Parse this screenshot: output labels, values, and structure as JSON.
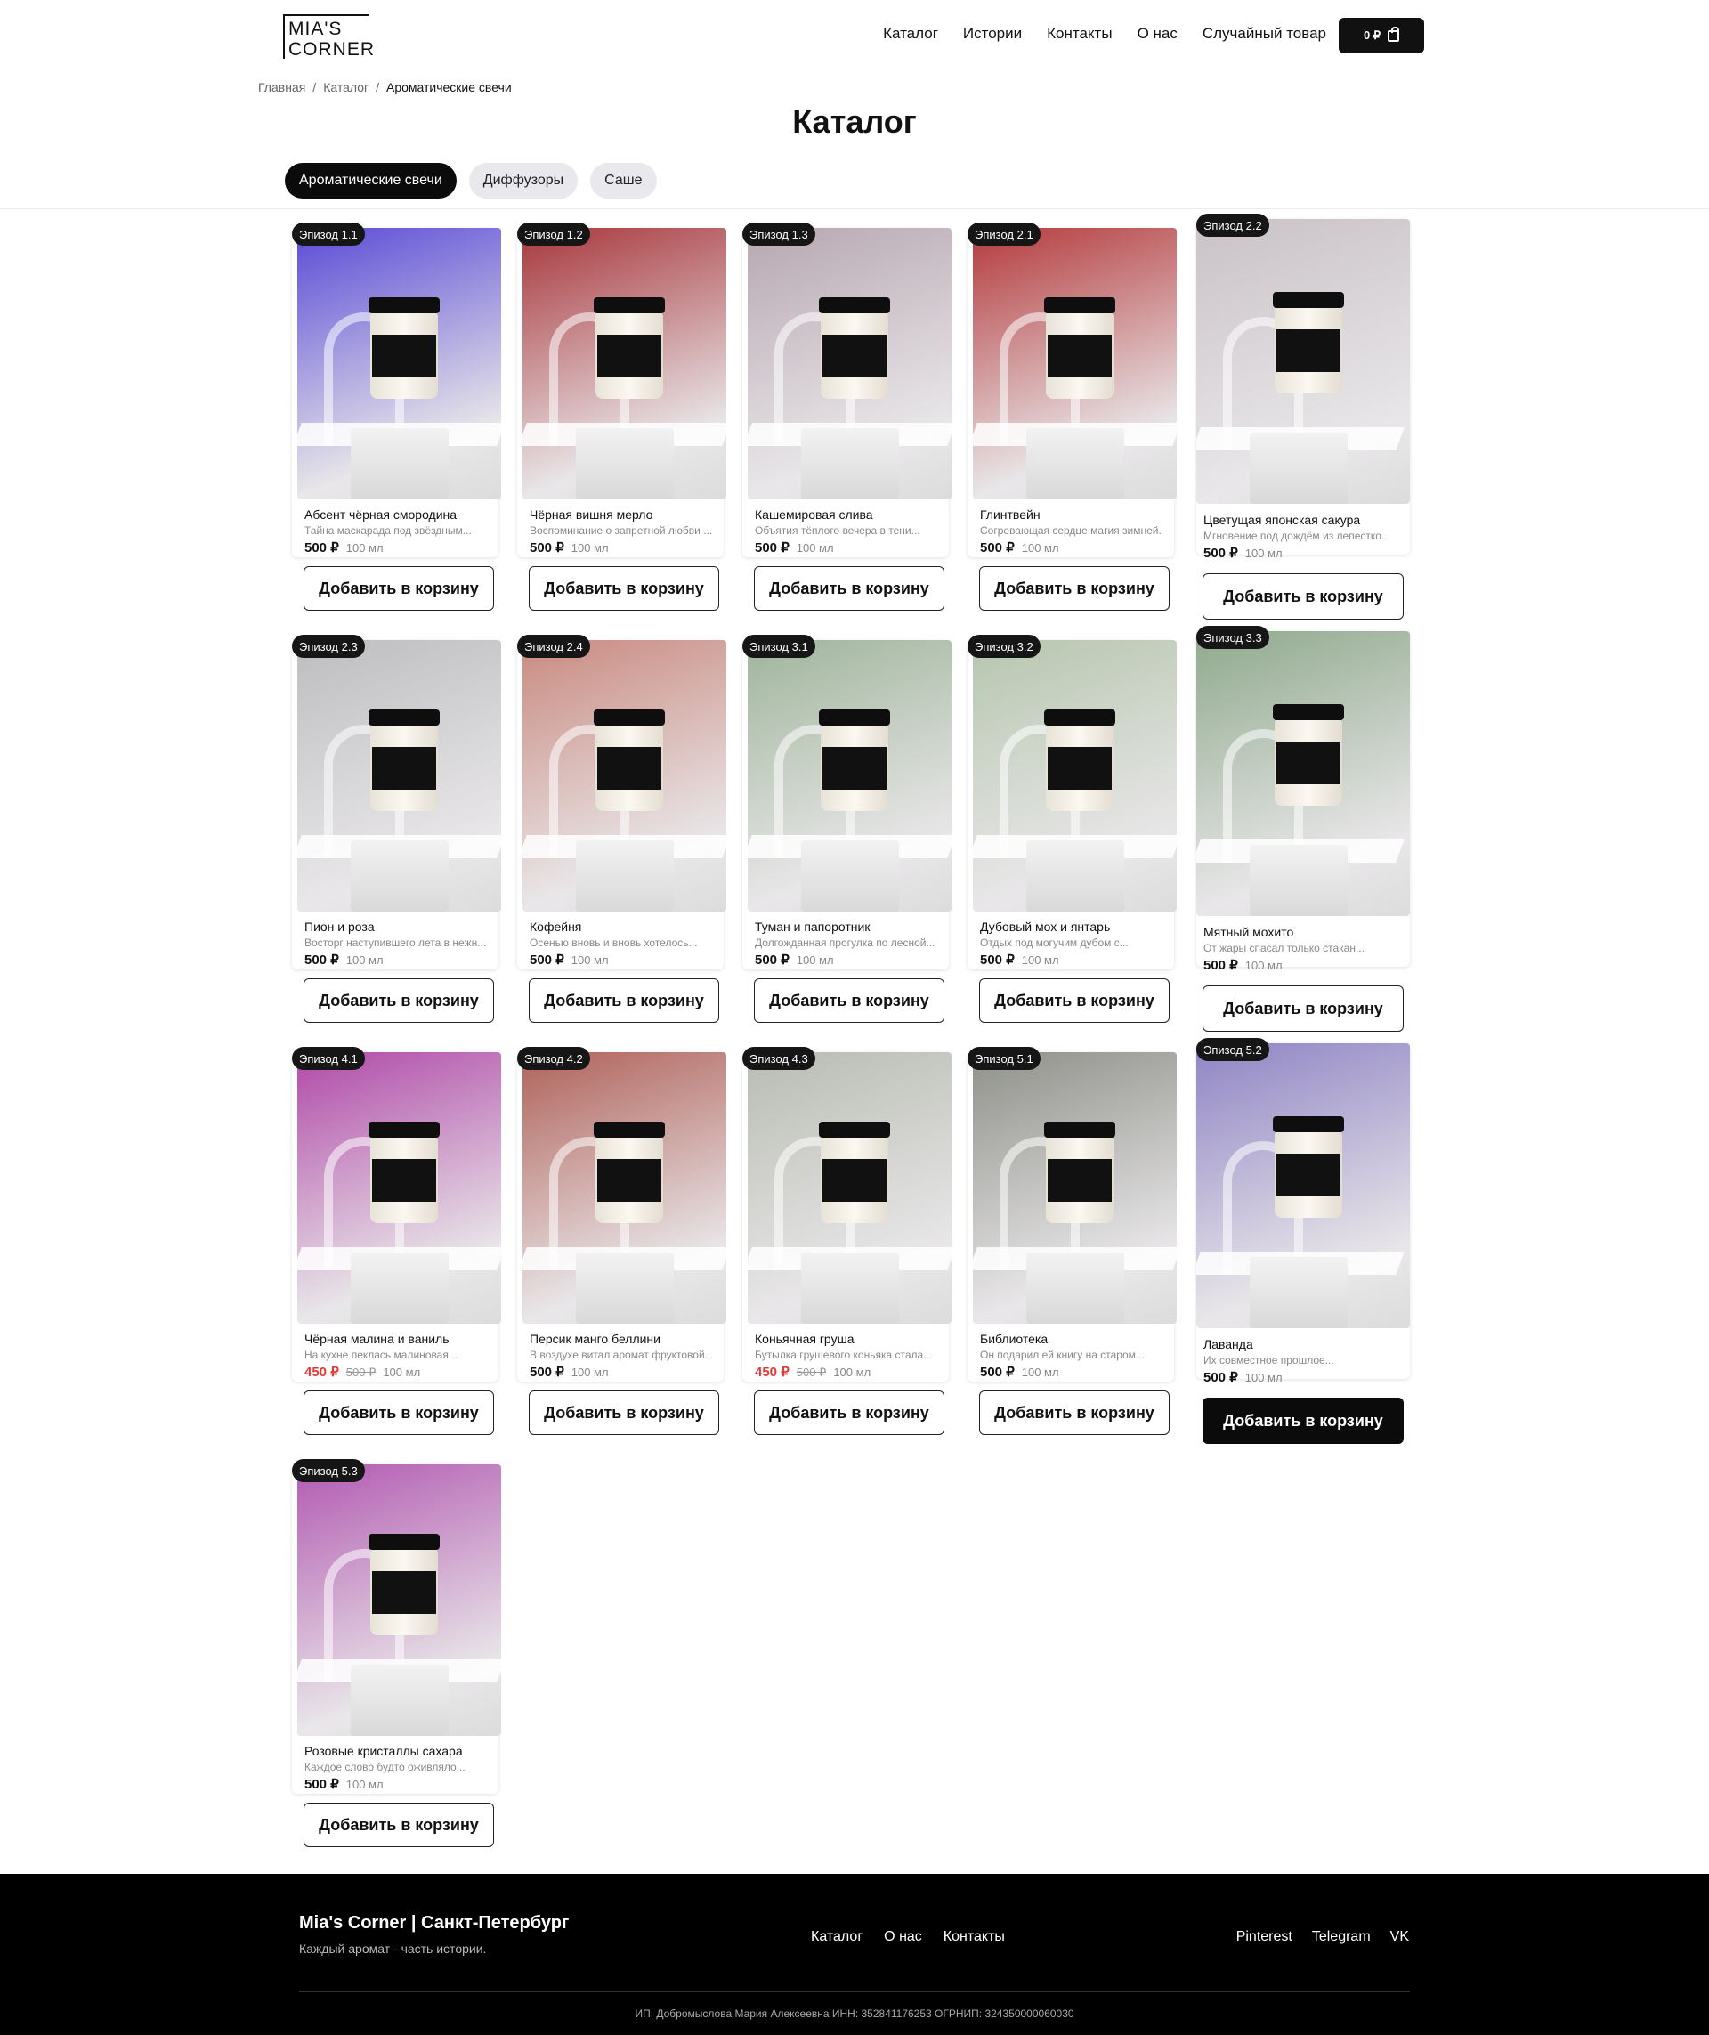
{
  "header": {
    "logo_line1": "MIA'S",
    "logo_line2": "CORNER",
    "nav": [
      "Каталог",
      "Истории",
      "Контакты",
      "О нас",
      "Случайный товар"
    ],
    "cart_total": "0 ₽",
    "cart_icon": "cart-icon"
  },
  "breadcrumb": [
    "Главная",
    "Каталог",
    "Ароматические свечи"
  ],
  "title": "Каталог",
  "tabs": [
    "Ароматические свечи",
    "Диффузоры",
    "Саше"
  ],
  "products": [
    {
      "episode": "Эпизод 1.1",
      "name": "Абсент чёрная смородина",
      "desc": "Тайна маскарада под звёздным...",
      "price": "500 ₽",
      "old_price": "",
      "volume": "100 мл",
      "button": "Добавить в корзину",
      "bg": "#5a4bd6"
    },
    {
      "episode": "Эпизод 1.2",
      "name": "Чёрная вишня мерло",
      "desc": "Воспоминание о запретной любви ...",
      "price": "500 ₽",
      "old_price": "",
      "volume": "100 мл",
      "button": "Добавить в корзину",
      "bg": "#a8373c"
    },
    {
      "episode": "Эпизод 1.3",
      "name": "Кашемировая слива",
      "desc": "Объятия тёплого вечера в тени...",
      "price": "500 ₽",
      "old_price": "",
      "volume": "100 мл",
      "button": "Добавить в корзину",
      "bg": "#b7a7b1"
    },
    {
      "episode": "Эпизод 2.1",
      "name": "Глинтвейн",
      "desc": "Согревающая сердце магия зимней...",
      "price": "500 ₽",
      "old_price": "",
      "volume": "100 мл",
      "button": "Добавить в корзину",
      "bg": "#b43a3c"
    },
    {
      "episode": "Эпизод 2.2",
      "name": "Цветущая японская сакура",
      "desc": "Мгновение под дождём из лепестко...",
      "price": "500 ₽",
      "old_price": "",
      "volume": "100 мл",
      "button": "Добавить в корзину",
      "bg": "#c9c2c7"
    },
    {
      "episode": "Эпизод 2.3",
      "name": "Пион и роза",
      "desc": "Восторг наступившего лета в нежн...",
      "price": "500 ₽",
      "old_price": "",
      "volume": "100 мл",
      "button": "Добавить в корзину",
      "bg": "#bdbdbf"
    },
    {
      "episode": "Эпизод 2.4",
      "name": "Кофейня",
      "desc": "Осенью вновь и вновь хотелось...",
      "price": "500 ₽",
      "old_price": "",
      "volume": "100 мл",
      "button": "Добавить в корзину",
      "bg": "#c98a80"
    },
    {
      "episode": "Эпизод 3.1",
      "name": "Туман и папоротник",
      "desc": "Долгожданная прогулка по лесной...",
      "price": "500 ₽",
      "old_price": "",
      "volume": "100 мл",
      "button": "Добавить в корзину",
      "bg": "#9fb59b"
    },
    {
      "episode": "Эпизод 3.2",
      "name": "Дубовый мох и янтарь",
      "desc": "Отдых под могучим дубом с...",
      "price": "500 ₽",
      "old_price": "",
      "volume": "100 мл",
      "button": "Добавить в корзину",
      "bg": "#b6c6ae"
    },
    {
      "episode": "Эпизод 3.3",
      "name": "Мятный мохито",
      "desc": "От жары спасал только стакан...",
      "price": "500 ₽",
      "old_price": "",
      "volume": "100 мл",
      "button": "Добавить в корзину",
      "bg": "#8fa98c"
    },
    {
      "episode": "Эпизод 4.1",
      "name": "Чёрная малина и ваниль",
      "desc": "На кухне пеклась малиновая...",
      "price": "450 ₽",
      "old_price": "500 ₽",
      "volume": "100 мл",
      "button": "Добавить в корзину",
      "bg": "#b04aa8"
    },
    {
      "episode": "Эпизод 4.2",
      "name": "Персик манго беллини",
      "desc": "В воздухе витал аромат фруктовой...",
      "price": "500 ₽",
      "old_price": "",
      "volume": "100 мл",
      "button": "Добавить в корзину",
      "bg": "#b0625a"
    },
    {
      "episode": "Эпизод 4.3",
      "name": "Коньячная груша",
      "desc": "Бутылка грушевого коньяка стала...",
      "price": "450 ₽",
      "old_price": "500 ₽",
      "volume": "100 мл",
      "button": "Добавить в корзину",
      "bg": "#b8bcb2"
    },
    {
      "episode": "Эпизод 5.1",
      "name": "Библиотека",
      "desc": "Он подарил ей книгу на старом...",
      "price": "500 ₽",
      "old_price": "",
      "volume": "100 мл",
      "button": "Добавить в корзину",
      "bg": "#8e9089"
    },
    {
      "episode": "Эпизод 5.2",
      "name": "Лаванда",
      "desc": "Их совместное прошлое...",
      "price": "500 ₽",
      "old_price": "",
      "volume": "100 мл",
      "button": "Добавить в корзину",
      "bg": "#8f84c4"
    },
    {
      "episode": "Эпизод 5.3",
      "name": "Розовые кристаллы сахара",
      "desc": "Каждое слово будто оживляло...",
      "price": "500 ₽",
      "old_price": "",
      "volume": "100 мл",
      "button": "Добавить в корзину",
      "bg": "#b25ab1"
    }
  ],
  "footer": {
    "brand": "Mia's Corner | Санкт-Петербург",
    "tagline": "Каждый аромат - часть истории.",
    "nav": [
      "Каталог",
      "О нас",
      "Контакты"
    ],
    "social": [
      "Pinterest",
      "Telegram",
      "VK"
    ],
    "legal": "ИП: Добромыслова Мария Алексеевна    ИНН: 352841176253    ОГРНИП: 324350000060030"
  }
}
